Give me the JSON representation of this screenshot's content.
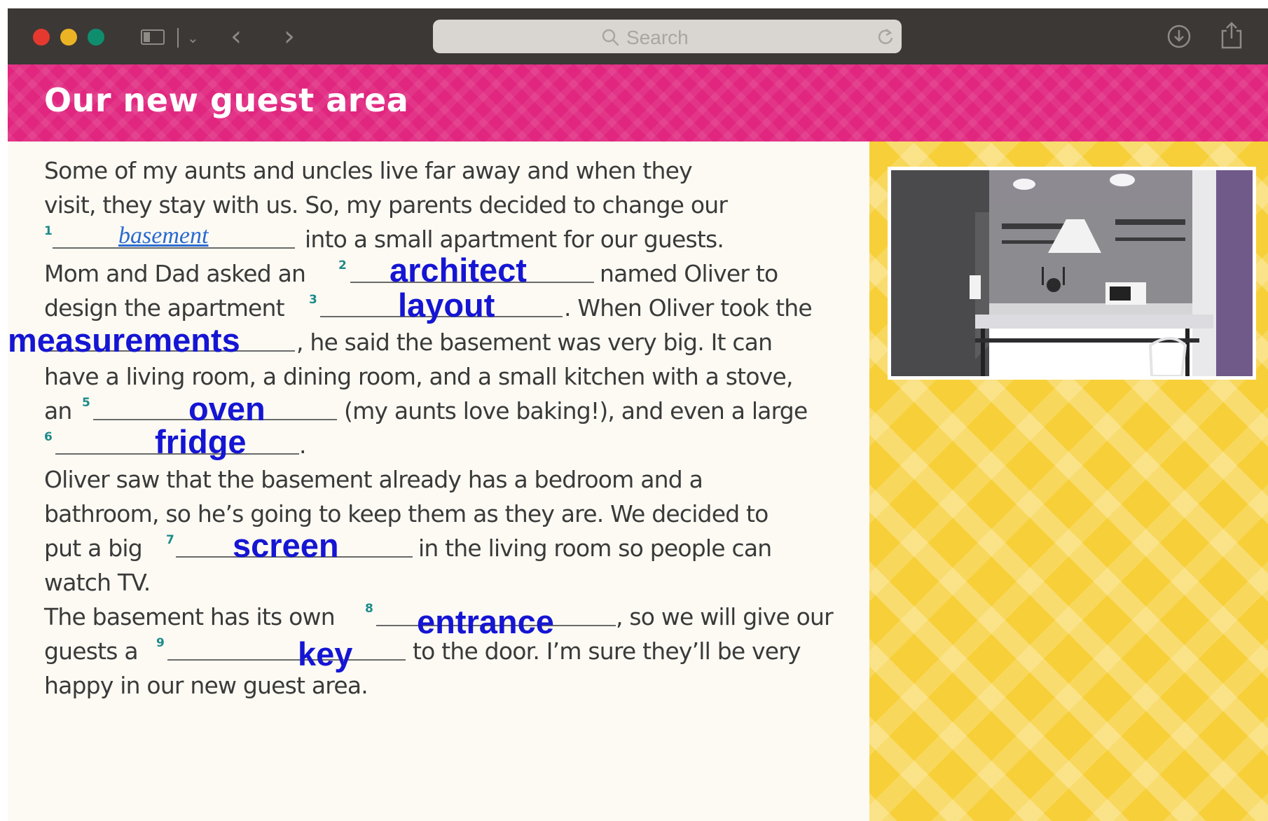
{
  "browser": {
    "search_placeholder": "Search",
    "traffic_lights": [
      "#e5392f",
      "#ecb424",
      "#0f8e6e"
    ]
  },
  "banner": {
    "title": "Our new guest area",
    "color": "#e0267f"
  },
  "article": {
    "line1": "Some of my aunts and uncles live far away and when they",
    "line2": "visit, they stay with us. So, my parents decided to change our",
    "gap1_number": "1",
    "gap1_answer": "basement",
    "line3_after": "into a small apartment for our guests.",
    "line4_before": "Mom and Dad asked an",
    "gap2_number": "2",
    "gap2_answer": "architect",
    "line4_after": "named Oliver to",
    "line5_before": "design the apartment",
    "gap3_number": "3",
    "gap3_answer": "layout",
    "line5_after": ". When Oliver took the",
    "gap4_answer": "measurements",
    "line6_after": ", he said the basement was very big. It can",
    "line7": "have a living room, a dining room, and a small kitchen with a stove,",
    "line8_before": "an",
    "gap5_number": "5",
    "gap5_answer": "oven",
    "line8_after": "(my aunts love baking!), and even a large",
    "gap6_number": "6",
    "gap6_answer": "fridge",
    "line9_after": ".",
    "line10": "Oliver saw that the basement already has a bedroom and a",
    "line11": "bathroom, so he’s going to keep them as they are. We decided to",
    "line12_before": "put a big",
    "gap7_number": "7",
    "gap7_answer": "screen",
    "line12_after": "in the living room so people can",
    "line13": "watch TV.",
    "line14_before": "The basement has its own",
    "gap8_number": "8",
    "gap8_answer": "entrance",
    "line14_after": ", so we will give our",
    "line15_before": "guests a",
    "gap9_number": "9",
    "gap9_answer": "key",
    "line15_after": "to the door. I’m sure they’ll be very",
    "line16": "happy in our new guest area."
  },
  "side_panel": {
    "photo": "kitchen-photo",
    "background_color": "#f7cf38"
  }
}
